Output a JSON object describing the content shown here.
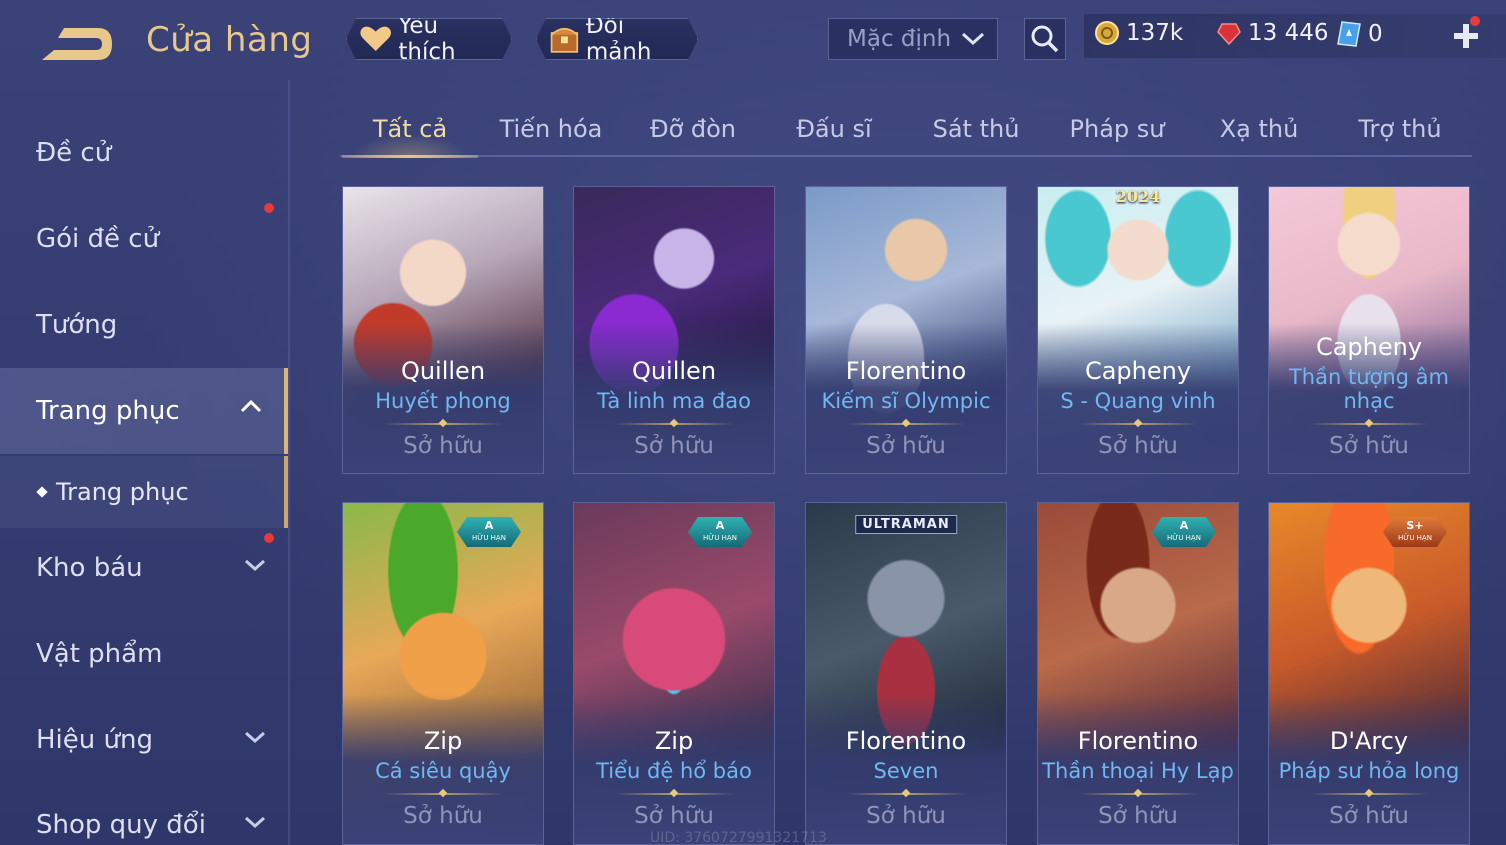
{
  "header": {
    "title": "Cửa hàng",
    "favorite_label": "Yêu thích",
    "exchange_label": "Đổi mảnh",
    "sort_value": "Mặc định",
    "currency": {
      "gold": "137k",
      "ruby": "13 446",
      "voucher": "0"
    }
  },
  "sidebar": {
    "items": [
      {
        "label": "Đề cử"
      },
      {
        "label": "Gói đề cử"
      },
      {
        "label": "Tướng"
      },
      {
        "label": "Trang phục"
      },
      {
        "label": "Kho báu"
      },
      {
        "label": "Vật phẩm"
      },
      {
        "label": "Hiệu ứng"
      },
      {
        "label": "Shop quy đổi"
      }
    ],
    "sub_item": "Trang phục"
  },
  "tabs": [
    {
      "label": "Tất cả"
    },
    {
      "label": "Tiến hóa"
    },
    {
      "label": "Đỡ đòn"
    },
    {
      "label": "Đấu sĩ"
    },
    {
      "label": "Sát thủ"
    },
    {
      "label": "Pháp sư"
    },
    {
      "label": "Xạ thủ"
    },
    {
      "label": "Trợ thủ"
    }
  ],
  "cards": [
    {
      "hero": "Quillen",
      "skin": "Huyết phong",
      "status": "Sở hữu",
      "badge": "",
      "tag": ""
    },
    {
      "hero": "Quillen",
      "skin": "Tà linh ma đao",
      "status": "Sở hữu",
      "badge": "",
      "tag": ""
    },
    {
      "hero": "Florentino",
      "skin": "Kiếm sĩ Olympic",
      "status": "Sở hữu",
      "badge": "",
      "tag": ""
    },
    {
      "hero": "Capheny",
      "skin": "S - Quang vinh",
      "status": "Sở hữu",
      "badge": "",
      "tag": "2024"
    },
    {
      "hero": "Capheny",
      "skin": "Thần tượng âm nhạc",
      "status": "Sở hữu",
      "badge": "",
      "tag": ""
    },
    {
      "hero": "Zip",
      "skin": "Cá siêu quậy",
      "status": "Sở hữu",
      "badge": "A",
      "badge_sub": "HỮU HẠN",
      "tag": ""
    },
    {
      "hero": "Zip",
      "skin": "Tiểu đệ hổ báo",
      "status": "Sở hữu",
      "badge": "A",
      "badge_sub": "HỮU HẠN",
      "tag": ""
    },
    {
      "hero": "Florentino",
      "skin": "Seven",
      "status": "Sở hữu",
      "badge": "",
      "tag": "ULTRAMAN"
    },
    {
      "hero": "Florentino",
      "skin": "Thần thoại Hy Lạp",
      "status": "Sở hữu",
      "badge": "A",
      "badge_sub": "HỮU HẠN",
      "tag": ""
    },
    {
      "hero": "D'Arcy",
      "skin": "Pháp sư hỏa long",
      "status": "Sở hữu",
      "badge": "S+",
      "badge_sub": "HỮU HẠN",
      "tag": ""
    }
  ],
  "footer": {
    "uid": "UID: 3760727991321713"
  },
  "colors": {
    "accent_gold": "#e8c88a",
    "skin_blue": "#6fb8f2",
    "alert_red": "#e63b3b",
    "background": "#333b6e"
  },
  "icons": {
    "back": "back-arrow-icon",
    "favorite": "heart-icon",
    "exchange": "chest-icon",
    "sort": "chevron-down-icon",
    "search": "search-icon",
    "gold": "gold-coin-icon",
    "ruby": "ruby-gem-icon",
    "voucher": "voucher-icon",
    "add": "plus-icon"
  }
}
